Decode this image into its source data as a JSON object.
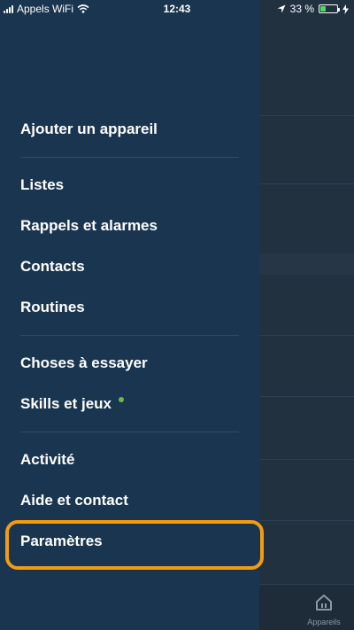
{
  "status_bar": {
    "carrier": "Appels WiFi",
    "time": "12:43",
    "battery_percent": "33 %",
    "battery_level": 0.33
  },
  "drawer": {
    "groups": [
      {
        "items": [
          {
            "label": "Ajouter un appareil"
          }
        ]
      },
      {
        "items": [
          {
            "label": "Listes"
          },
          {
            "label": "Rappels et alarmes"
          },
          {
            "label": "Contacts"
          },
          {
            "label": "Routines"
          }
        ]
      },
      {
        "items": [
          {
            "label": "Choses à essayer"
          },
          {
            "label": "Skills et jeux",
            "new_indicator": true
          }
        ]
      },
      {
        "items": [
          {
            "label": "Activité"
          },
          {
            "label": "Aide et contact"
          },
          {
            "label": "Paramètres",
            "highlighted": true
          }
        ]
      }
    ]
  },
  "background_app": {
    "tab_bar": {
      "appareils_label": "Appareils"
    }
  },
  "colors": {
    "drawer_bg": "#1a3550",
    "highlight": "#f39c12",
    "new_dot": "#6dbb3c"
  }
}
